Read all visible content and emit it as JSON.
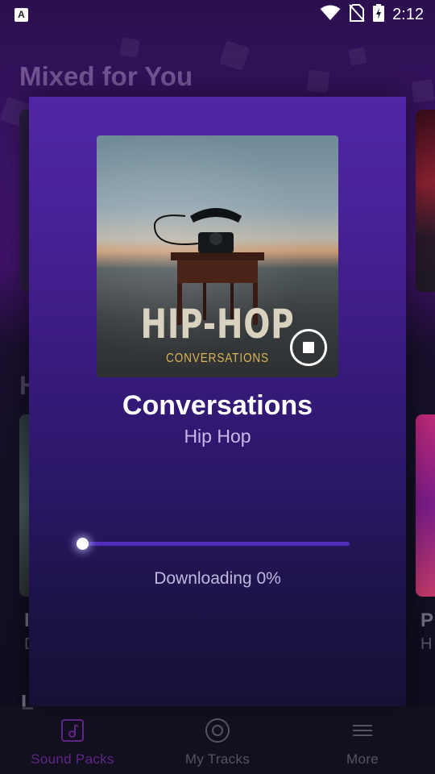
{
  "status_bar": {
    "time": "2:12",
    "notification_icon_letter": "A"
  },
  "background": {
    "heading": "Mixed for You",
    "second_heading_partial": "H",
    "card_title_left_partial": "I",
    "card_sub_left_partial": "D",
    "card_title_right_partial": "P",
    "card_sub_right_partial": "H",
    "third_heading_partial": "L"
  },
  "modal": {
    "cover_title": "HIP-HOP",
    "cover_subtitle": "CONVERSATIONS",
    "pack_title": "Conversations",
    "pack_genre": "Hip Hop",
    "download_status": "Downloading 0%",
    "progress_fraction": 0
  },
  "bottom_nav": {
    "items": [
      {
        "label": "Sound Packs",
        "icon": "music-note-icon",
        "active": true
      },
      {
        "label": "My Tracks",
        "icon": "record-disc-icon",
        "active": false
      },
      {
        "label": "More",
        "icon": "hamburger-menu-icon",
        "active": false
      }
    ]
  },
  "colors": {
    "accent": "#a23be0",
    "modal_top": "#5127a6",
    "modal_bottom": "#161036",
    "progress_track": "#4f2fb8"
  }
}
